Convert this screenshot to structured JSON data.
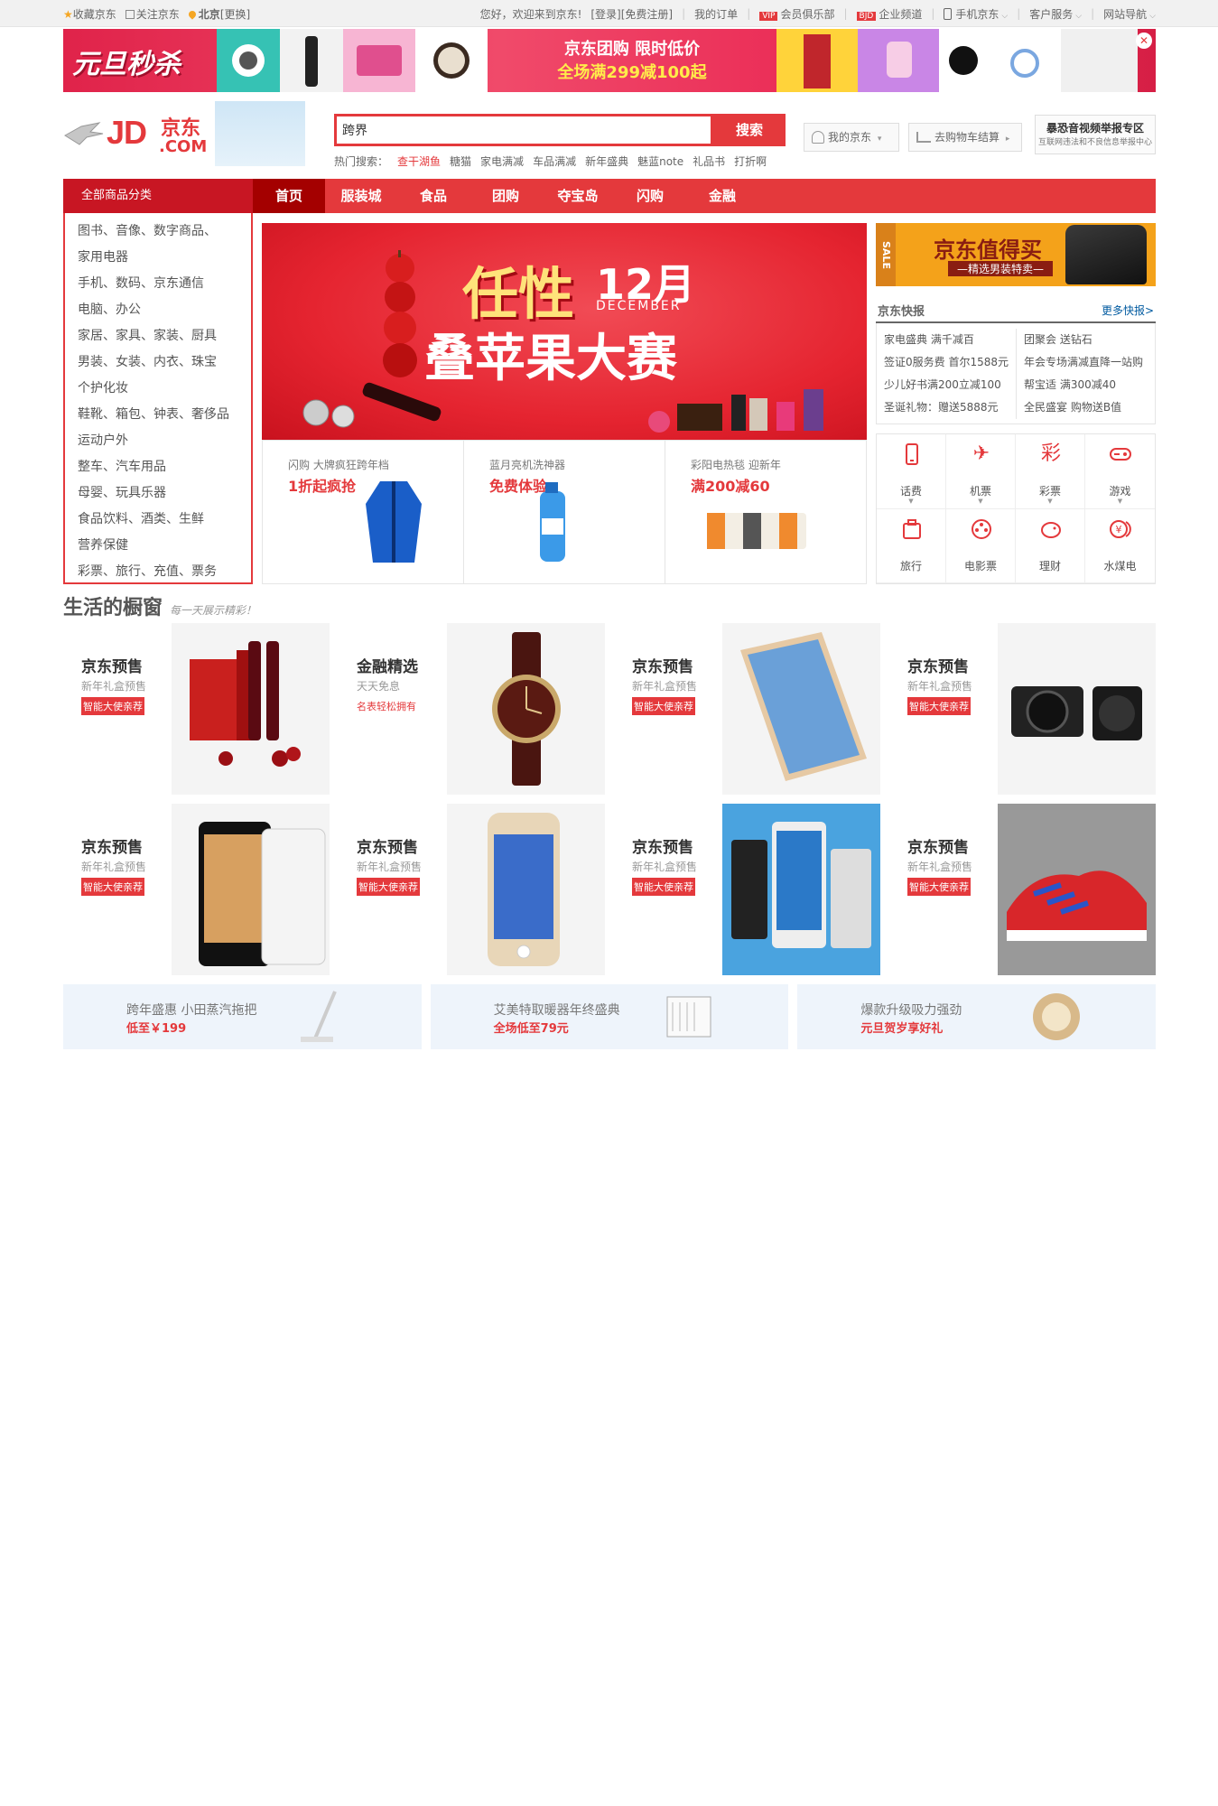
{
  "topbar": {
    "favorite": "收藏京东",
    "follow": "关注京东",
    "city": "北京",
    "change_city": "[更换]",
    "welcome": "您好，欢迎来到京东!",
    "login": "[登录]",
    "register": "[免费注册]",
    "my_orders": "我的订单",
    "vip_tag": "VIP",
    "vip_club": "会员俱乐部",
    "bjd_tag": "BJD",
    "enterprise": "企业频道",
    "mobile_jd": "手机京东",
    "customer_service": "客户服务",
    "site_nav": "网站导航"
  },
  "promo": {
    "left_text": "元旦秒杀",
    "line1": "京东团购 限时低价",
    "line2": "全场满299减100起"
  },
  "logo": {
    "text_jd": "JD",
    "text_cn": "京东",
    "text_com": ".COM"
  },
  "search": {
    "value": "跨界",
    "button": "搜索",
    "hot_label": "热门搜索：",
    "hot_words": [
      "查干湖鱼",
      "糖猫",
      "家电满减",
      "车品满减",
      "新年盛典",
      "魅蓝note",
      "礼品书",
      "打折啊"
    ]
  },
  "header": {
    "my_jd": "我的京东",
    "cart": "去购物车结算",
    "report_title": "暴恐音视频举报专区",
    "report_sub": "互联网违法和不良信息举报中心"
  },
  "nav": {
    "all_categories": "全部商品分类",
    "items": [
      "首页",
      "服装城",
      "食品",
      "团购",
      "夺宝岛",
      "闪购",
      "金融"
    ]
  },
  "categories": [
    "图书、音像、数字商品、",
    "家用电器",
    "手机、数码、京东通信",
    "电脑、办公",
    "家居、家具、家装、厨具",
    "男装、女装、内衣、珠宝",
    "个护化妆",
    "鞋靴、箱包、钟表、奢侈品",
    "运动户外",
    "整车、汽车用品",
    "母婴、玩具乐器",
    "食品饮料、酒类、生鲜",
    "营养保健",
    "彩票、旅行、充值、票务"
  ],
  "slider": {
    "word1": "任性",
    "month": "12月",
    "dec": "DECEMBER",
    "word2": "叠苹果大赛"
  },
  "subads": [
    {
      "s1": "闪购 大牌疯狂跨年档",
      "s2": "1折起疯抢"
    },
    {
      "s1": "蓝月亮机洗神器",
      "s2": "免费体验"
    },
    {
      "s1": "彩阳电热毯 迎新年",
      "s2": "满200减60"
    }
  ],
  "sale_ad": {
    "bar": "SALE",
    "title": "京东值得买",
    "sub": "—精选男装特卖—"
  },
  "kuaibao": {
    "title": "京东快报",
    "more": "更多快报>",
    "news": [
      "家电盛典 满千减百",
      "团聚会 送钻石",
      "签证0服务费 首尔1588元",
      "年会专场满减直降一站购",
      "少儿好书满200立减100",
      "帮宝适 满300减40",
      "圣诞礼物：赠送5888元",
      "全民盛宴 购物送B值"
    ]
  },
  "services": [
    {
      "label": "话费",
      "icon": "phone-icon",
      "glyph": "▯",
      "arrow": true
    },
    {
      "label": "机票",
      "icon": "plane-icon",
      "glyph": "✈",
      "arrow": true
    },
    {
      "label": "彩票",
      "icon": "lottery-icon",
      "glyph": "彩",
      "arrow": true
    },
    {
      "label": "游戏",
      "icon": "gamepad-icon",
      "glyph": "⊙",
      "arrow": true
    },
    {
      "label": "旅行",
      "icon": "luggage-icon",
      "glyph": "▣",
      "arrow": false
    },
    {
      "label": "电影票",
      "icon": "film-icon",
      "glyph": "◎",
      "arrow": false
    },
    {
      "label": "理财",
      "icon": "piggy-bank-icon",
      "glyph": "♥",
      "arrow": false
    },
    {
      "label": "水煤电",
      "icon": "yuan-coin-icon",
      "glyph": "¥",
      "arrow": false
    }
  ],
  "life": {
    "title": "生活的橱窗",
    "subtitle": "每一天展示精彩！",
    "tiles": [
      {
        "t1": "京东预售",
        "t2": "新年礼盒预售",
        "t3": "智能大使亲荐",
        "img": "wine-gift-box",
        "plain": false
      },
      {
        "t1": "金融精选",
        "t2": "天天免息",
        "t3": "名表轻松拥有",
        "img": "watch",
        "plain": true
      },
      {
        "t1": "京东预售",
        "t2": "新年礼盒预售",
        "t3": "智能大使亲荐",
        "img": "tablet",
        "plain": false
      },
      {
        "t1": "京东预售",
        "t2": "新年礼盒预售",
        "t3": "智能大使亲荐",
        "img": "camera",
        "plain": false
      },
      {
        "t1": "京东预售",
        "t2": "新年礼盒预售",
        "t3": "智能大使亲荐",
        "img": "smartphone",
        "plain": false
      },
      {
        "t1": "京东预售",
        "t2": "新年礼盒预售",
        "t3": "智能大使亲荐",
        "img": "iphone",
        "plain": false
      },
      {
        "t1": "京东预售",
        "t2": "新年礼盒预售",
        "t3": "智能大使亲荐",
        "img": "phones",
        "plain": false
      },
      {
        "t1": "京东预售",
        "t2": "新年礼盒预售",
        "t3": "智能大使亲荐",
        "img": "sneakers",
        "plain": false
      }
    ]
  },
  "bottom_ads": [
    {
      "b1": "跨年盛惠 小田蒸汽拖把",
      "b2": "低至￥199"
    },
    {
      "b1": "艾美特取暖器年终盛典",
      "b2": "全场低至79元"
    },
    {
      "b1": "爆款升级吸力强劲",
      "b2": "元旦贺岁享好礼"
    }
  ],
  "colors": {
    "brand_red": "#e4393c",
    "nav_active": "#a40000",
    "link_blue": "#005aa0"
  }
}
